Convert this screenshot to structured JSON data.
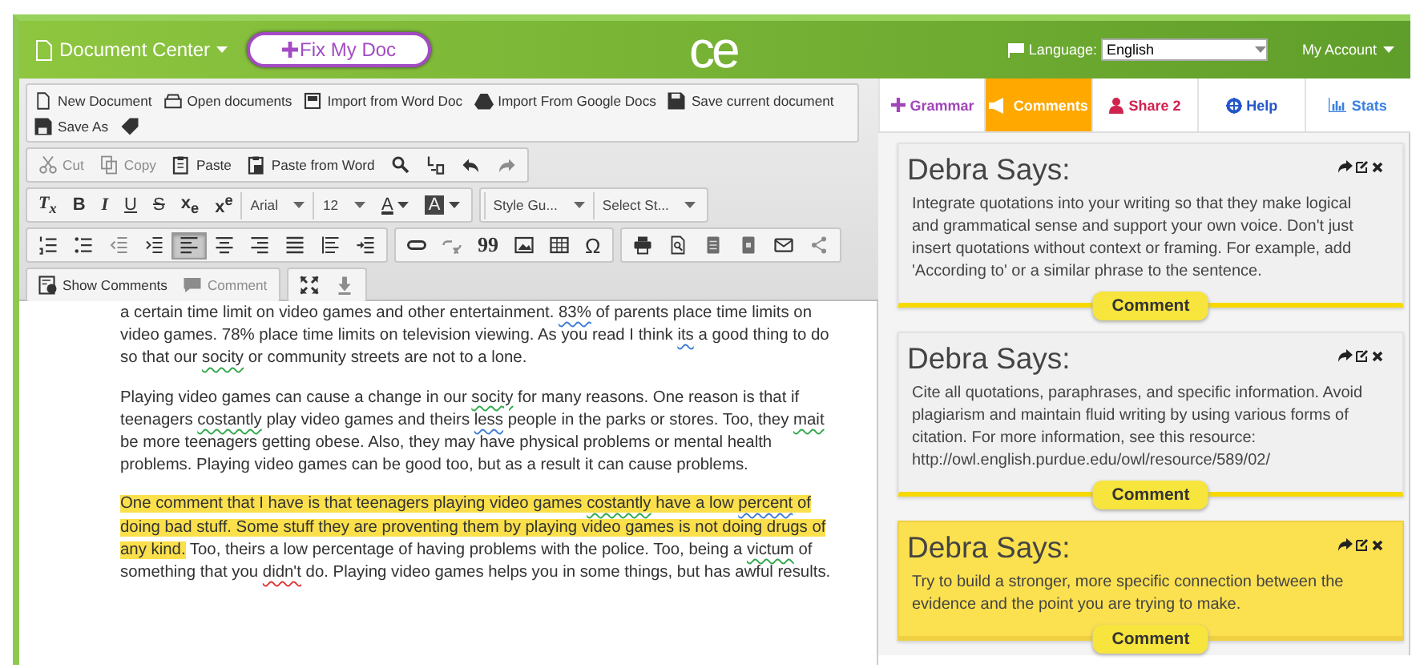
{
  "header": {
    "title": "Document Center",
    "fix_button": "Fix My Doc",
    "logo": "ce",
    "language_label": "Language:",
    "language": "English",
    "account": "My Account"
  },
  "file_menu": [
    {
      "kind": "new",
      "label": "New Document"
    },
    {
      "kind": "open",
      "label": "Open documents"
    },
    {
      "kind": "word",
      "label": "Import from Word Doc"
    },
    {
      "kind": "drive",
      "label": "Import From Google Docs"
    },
    {
      "kind": "save",
      "label": "Save current document"
    },
    {
      "kind": "saveas",
      "label": "Save As"
    },
    {
      "kind": "tag"
    }
  ],
  "toolbar_rows": [
    {
      "groups": [
        {
          "items": [
            {
              "kind": "cut",
              "label": "Cut",
              "disabled": true,
              "pressed": false
            },
            {
              "kind": "copy",
              "label": "Copy",
              "disabled": true,
              "pressed": false
            },
            {
              "kind": "paste",
              "label": "Paste",
              "disabled": false,
              "pressed": false
            },
            {
              "kind": "paste-word",
              "label": "Paste from Word",
              "disabled": false,
              "pressed": false
            },
            {
              "kind": "find",
              "disabled": false,
              "pressed": false
            },
            {
              "kind": "replace",
              "disabled": false,
              "pressed": false
            },
            {
              "kind": "undo",
              "disabled": false,
              "pressed": false
            },
            {
              "kind": "redo",
              "disabled": true,
              "pressed": false
            }
          ]
        }
      ]
    },
    {
      "groups": [
        {
          "items": [
            {
              "kind": "clear-format",
              "label": "T$_{x}$",
              "disabled": false,
              "pressed": false
            },
            {
              "kind": "bold",
              "label": "B",
              "disabled": false,
              "pressed": false
            },
            {
              "kind": "italic",
              "label": "I",
              "disabled": false,
              "pressed": false
            },
            {
              "kind": "underline",
              "label": "U",
              "disabled": false,
              "pressed": false
            },
            {
              "kind": "strike",
              "label": "S",
              "disabled": false,
              "pressed": false
            },
            {
              "kind": "subscript",
              "label": "x$_{e}$",
              "disabled": false,
              "pressed": false
            },
            {
              "kind": "superscript",
              "label": "x$^{e}$",
              "disabled": false,
              "pressed": false
            },
            {
              "kind": "select",
              "label": "Arial"
            },
            {
              "kind": "select",
              "label": "12"
            },
            {
              "kind": "text-color",
              "label": "A",
              "disabled": false,
              "pressed": false
            },
            {
              "kind": "bg-color",
              "label": "A",
              "disabled": false,
              "pressed": false
            }
          ]
        },
        {
          "items": [
            {
              "kind": "select",
              "label": "Style Gu..."
            },
            {
              "kind": "select",
              "label": "Select St..."
            }
          ]
        }
      ]
    },
    {
      "groups": [
        {
          "items": [
            {
              "kind": "numbered-list",
              "disabled": false,
              "pressed": false
            },
            {
              "kind": "bullet-list",
              "disabled": false,
              "pressed": false
            },
            {
              "kind": "outdent",
              "disabled": true,
              "pressed": false
            },
            {
              "kind": "indent",
              "disabled": false,
              "pressed": false
            },
            {
              "kind": "align-left",
              "disabled": false,
              "pressed": true
            },
            {
              "kind": "align-center",
              "disabled": false,
              "pressed": false
            },
            {
              "kind": "align-right",
              "disabled": false,
              "pressed": false
            },
            {
              "kind": "justify",
              "disabled": false,
              "pressed": false
            },
            {
              "kind": "block",
              "disabled": false,
              "pressed": false
            },
            {
              "kind": "ltr",
              "disabled": false,
              "pressed": false
            }
          ]
        },
        {
          "items": [
            {
              "kind": "link",
              "disabled": false,
              "pressed": false
            },
            {
              "kind": "unlink",
              "disabled": true,
              "pressed": false
            },
            {
              "kind": "quote",
              "label": "99",
              "disabled": false,
              "pressed": false
            },
            {
              "kind": "image",
              "disabled": false,
              "pressed": false
            },
            {
              "kind": "table",
              "disabled": false,
              "pressed": false
            },
            {
              "kind": "special",
              "label": "Ω",
              "disabled": false,
              "pressed": false
            }
          ]
        },
        {
          "items": [
            {
              "kind": "print",
              "disabled": false,
              "pressed": false
            },
            {
              "kind": "preview",
              "disabled": false,
              "pressed": false
            },
            {
              "kind": "doc",
              "disabled": false,
              "pressed": false
            },
            {
              "kind": "pdf",
              "disabled": false,
              "pressed": false
            },
            {
              "kind": "mail",
              "disabled": false,
              "pressed": false
            },
            {
              "kind": "share",
              "disabled": true,
              "pressed": false
            }
          ]
        }
      ]
    },
    {
      "groups": [
        {
          "items": [
            {
              "kind": "show-comments",
              "label": "Show Comments",
              "disabled": false,
              "pressed": false
            },
            {
              "kind": "comment",
              "label": "Comment",
              "disabled": true,
              "pressed": false
            }
          ]
        },
        {
          "items": [
            {
              "kind": "fullscreen",
              "disabled": false,
              "pressed": false
            },
            {
              "kind": "download",
              "disabled": true,
              "pressed": false
            }
          ]
        }
      ]
    }
  ],
  "document": {
    "paragraphs": [
      {
        "segments": [
          {
            "kind": "plain",
            "text": "a certain time limit on video games and other entertainment. ",
            "highlight": false
          },
          {
            "kind": "grammar",
            "text": "83%",
            "highlight": false
          },
          {
            "kind": "plain",
            "text": " of parents place time limits on video games. 78% place time limits on television viewing. As you read I think ",
            "highlight": false
          },
          {
            "kind": "grammar",
            "text": "its",
            "highlight": false
          },
          {
            "kind": "plain",
            "text": " a good thing to do so that our ",
            "highlight": false
          },
          {
            "kind": "spelling",
            "text": "socity",
            "highlight": false
          },
          {
            "kind": "plain",
            "text": " or community streets are not to a lone.",
            "highlight": false
          }
        ]
      },
      {
        "segments": [
          {
            "kind": "plain",
            "text": "Playing video games can cause a change in our ",
            "highlight": false
          },
          {
            "kind": "spelling",
            "text": "socity",
            "highlight": false
          },
          {
            "kind": "plain",
            "text": " for many reasons. One reason is that if teenagers ",
            "highlight": false
          },
          {
            "kind": "spelling",
            "text": "costantly",
            "highlight": false
          },
          {
            "kind": "plain",
            "text": " play video games and theirs ",
            "highlight": false
          },
          {
            "kind": "grammar",
            "text": "less",
            "highlight": false
          },
          {
            "kind": "plain",
            "text": " people in the parks or stores. Too, they ",
            "highlight": false
          },
          {
            "kind": "spelling",
            "text": "mait",
            "highlight": false
          },
          {
            "kind": "plain",
            "text": " be more teenagers getting obese. Also, they may have physical problems or mental health problems. Playing video games can be good too, but as a result it can cause problems.",
            "highlight": false
          }
        ]
      },
      {
        "segments": [
          {
            "kind": "plain",
            "text": "One comment that I have is that teenagers playing video games ",
            "highlight": true
          },
          {
            "kind": "spelling",
            "text": "costantly",
            "highlight": true
          },
          {
            "kind": "plain",
            "text": " have a low ",
            "highlight": true
          },
          {
            "kind": "grammar",
            "text": "percent",
            "highlight": true
          },
          {
            "kind": "plain",
            "text": " of doing bad stuff. Some stuff they are proventing them by playing video games is not doing drugs of any kind.",
            "highlight": true
          },
          {
            "kind": "plain",
            "text": " Too, theirs a low percentage of having problems with the police. Too, being a ",
            "highlight": false
          },
          {
            "kind": "spelling",
            "text": "victum",
            "highlight": false
          },
          {
            "kind": "plain",
            "text": " of something that you ",
            "highlight": false
          },
          {
            "kind": "error",
            "text": "didn't",
            "highlight": false
          },
          {
            "kind": "plain",
            "text": " do. Playing video games helps you in some things, but has awful results.",
            "highlight": false
          }
        ]
      }
    ]
  },
  "tabs": [
    {
      "kind": "grammar",
      "label": "Grammar",
      "color": "#a046b8",
      "selected": false
    },
    {
      "kind": "comments",
      "label": "Comments",
      "color": "#ffa800",
      "selected": true
    },
    {
      "kind": "share",
      "label": "Share 2",
      "color": "#d0234e",
      "selected": false
    },
    {
      "kind": "help",
      "label": "Help",
      "color": "#2356c8",
      "selected": false
    },
    {
      "kind": "stats",
      "label": "Stats",
      "color": "#3a80e0",
      "selected": false
    }
  ],
  "comments": [
    {
      "author": "Debra Says:",
      "body": "Integrate quotations into your writing so that they make logical and grammatical sense and support your own voice. Don't just insert quotations without context or framing. For example, add 'According to' or a similar phrase to the sentence.",
      "button": "Comment",
      "selected": false
    },
    {
      "author": "Debra Says:",
      "body": "Cite all quotations, paraphrases, and specific information. Avoid plagiarism and maintain fluid writing by using various forms of citation. For more information, see this resource: http://owl.english.purdue.edu/owl/resource/589/02/",
      "button": "Comment",
      "selected": false
    },
    {
      "author": "Debra Says:",
      "body": "Try to build a stronger, more specific connection between the evidence and the point you are trying to make.",
      "button": "Comment",
      "selected": true
    }
  ]
}
